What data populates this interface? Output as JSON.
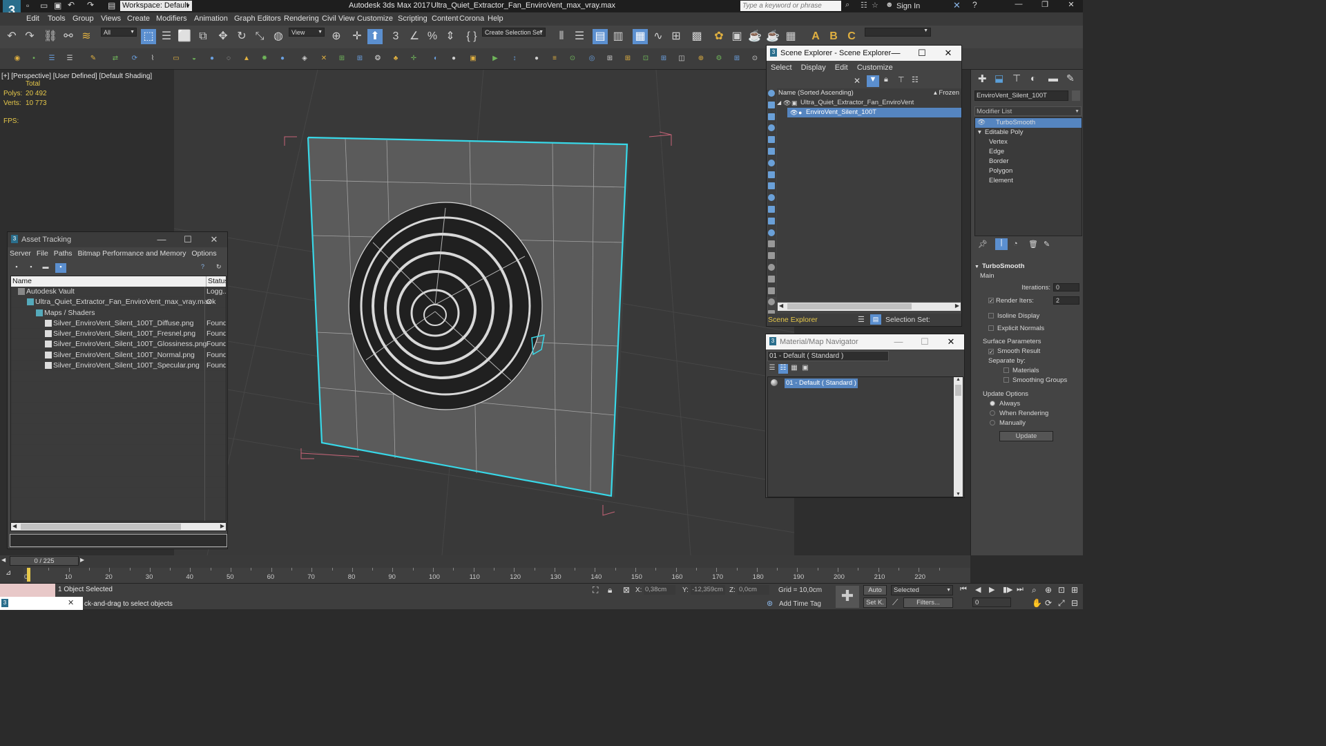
{
  "titlebar": {
    "workspace": "Workspace: Default",
    "title": "Autodesk 3ds Max 2017",
    "filename": "Ultra_Quiet_Extractor_Fan_EnviroVent_max_vray.max",
    "search_placeholder": "Type a keyword or phrase",
    "sign_in": "Sign In"
  },
  "menu": [
    "Edit",
    "Tools",
    "Group",
    "Views",
    "Create",
    "Modifiers",
    "Animation",
    "Graph Editors",
    "Rendering",
    "Civil View",
    "Customize",
    "Scripting",
    "Content",
    "Corona",
    "Help"
  ],
  "toolbar": {
    "filter": "All",
    "refcoord": "View",
    "selection_set": "Create Selection Set"
  },
  "viewport": {
    "label_plus": "[+]",
    "label_view": "[Perspective]",
    "label_user": "[User Defined]",
    "label_shading": "[Default Shading]",
    "stats_total": "Total",
    "polys_label": "Polys:",
    "polys_value": "20 492",
    "verts_label": "Verts:",
    "verts_value": "10 773",
    "fps_label": "FPS:"
  },
  "asset_tracking": {
    "title": "Asset Tracking",
    "menu": [
      "Server",
      "File",
      "Paths",
      "Bitmap Performance and Memory",
      "Options"
    ],
    "col_name": "Name",
    "col_status": "Status",
    "rows": [
      {
        "name": "Autodesk Vault",
        "status": "Logg...",
        "indent": 0,
        "icon": "vault-icon"
      },
      {
        "name": "Ultra_Quiet_Extractor_Fan_EnviroVent_max_vray.max",
        "status": "Ok",
        "indent": 1,
        "icon": "max-file-icon"
      },
      {
        "name": "Maps / Shaders",
        "status": "",
        "indent": 2,
        "icon": "folder-icon"
      },
      {
        "name": "Silver_EnviroVent_Silent_100T_Diffuse.png",
        "status": "Found",
        "indent": 3,
        "icon": "bitmap-icon"
      },
      {
        "name": "Silver_EnviroVent_Silent_100T_Fresnel.png",
        "status": "Found",
        "indent": 3,
        "icon": "bitmap-icon"
      },
      {
        "name": "Silver_EnviroVent_Silent_100T_Glossiness.png",
        "status": "Found",
        "indent": 3,
        "icon": "bitmap-icon"
      },
      {
        "name": "Silver_EnviroVent_Silent_100T_Normal.png",
        "status": "Found",
        "indent": 3,
        "icon": "bitmap-icon"
      },
      {
        "name": "Silver_EnviroVent_Silent_100T_Specular.png",
        "status": "Found",
        "indent": 3,
        "icon": "bitmap-icon"
      }
    ]
  },
  "scene_explorer": {
    "title": "Scene Explorer - Scene Explorer",
    "menu": [
      "Select",
      "Display",
      "Edit",
      "Customize"
    ],
    "col_name": "Name (Sorted Ascending)",
    "col_frozen": "▴ Frozen",
    "items": [
      {
        "name": "Ultra_Quiet_Extractor_Fan_EnviroVent",
        "selected": false
      },
      {
        "name": "EnviroVent_Silent_100T",
        "selected": true
      }
    ],
    "footer_name": "Scene Explorer",
    "selection_set": "Selection Set:"
  },
  "material_navigator": {
    "title": "Material/Map Navigator",
    "current": "01 - Default  ( Standard )",
    "item": "01 - Default  ( Standard )"
  },
  "command_panel": {
    "object_name": "EnviroVent_Silent_100T",
    "modifier_list": "Modifier List",
    "stack": [
      {
        "label": "TurboSmooth",
        "level": 0,
        "selected": true
      },
      {
        "label": "Editable Poly",
        "level": 0,
        "selected": false
      },
      {
        "label": "Vertex",
        "level": 1,
        "selected": false
      },
      {
        "label": "Edge",
        "level": 1,
        "selected": false
      },
      {
        "label": "Border",
        "level": 1,
        "selected": false
      },
      {
        "label": "Polygon",
        "level": 1,
        "selected": false
      },
      {
        "label": "Element",
        "level": 1,
        "selected": false
      }
    ],
    "rollout_title": "TurboSmooth",
    "main": "Main",
    "iterations_label": "Iterations:",
    "iterations_value": "0",
    "render_iters_label": "Render Iters:",
    "render_iters_value": "2",
    "isoline": "Isoline Display",
    "explicit_normals": "Explicit Normals",
    "surface_params": "Surface Parameters",
    "smooth_result": "Smooth Result",
    "separate_by": "Separate by:",
    "materials": "Materials",
    "smoothing_groups": "Smoothing Groups",
    "update_options": "Update Options",
    "always": "Always",
    "when_rendering": "When Rendering",
    "manually": "Manually",
    "update_button": "Update"
  },
  "timeline": {
    "frame": "0 / 225",
    "ticks": [
      "0",
      "10",
      "20",
      "30",
      "40",
      "50",
      "60",
      "70",
      "80",
      "90",
      "100",
      "110",
      "120",
      "130",
      "140",
      "150",
      "160",
      "170",
      "180",
      "190",
      "200",
      "210",
      "220"
    ]
  },
  "status": {
    "selected": "1 Object Selected",
    "prompt": "ck-and-drag to select objects",
    "x_label": "X:",
    "x_value": "0,38cm",
    "y_label": "Y:",
    "y_value": "-12,359cm",
    "z_label": "Z:",
    "z_value": "0,0cm",
    "grid": "Grid = 10,0cm",
    "add_time_tag": "Add Time Tag",
    "auto": "Auto",
    "set_k": "Set K.",
    "key_mode": "Selected",
    "filters": "Filters...",
    "frame_field": "0"
  },
  "colors": {
    "accent": "#5585c0",
    "selection_wire": "#38d8e8",
    "bbox": "#c86478",
    "stats_yellow": "#e6c84a"
  }
}
